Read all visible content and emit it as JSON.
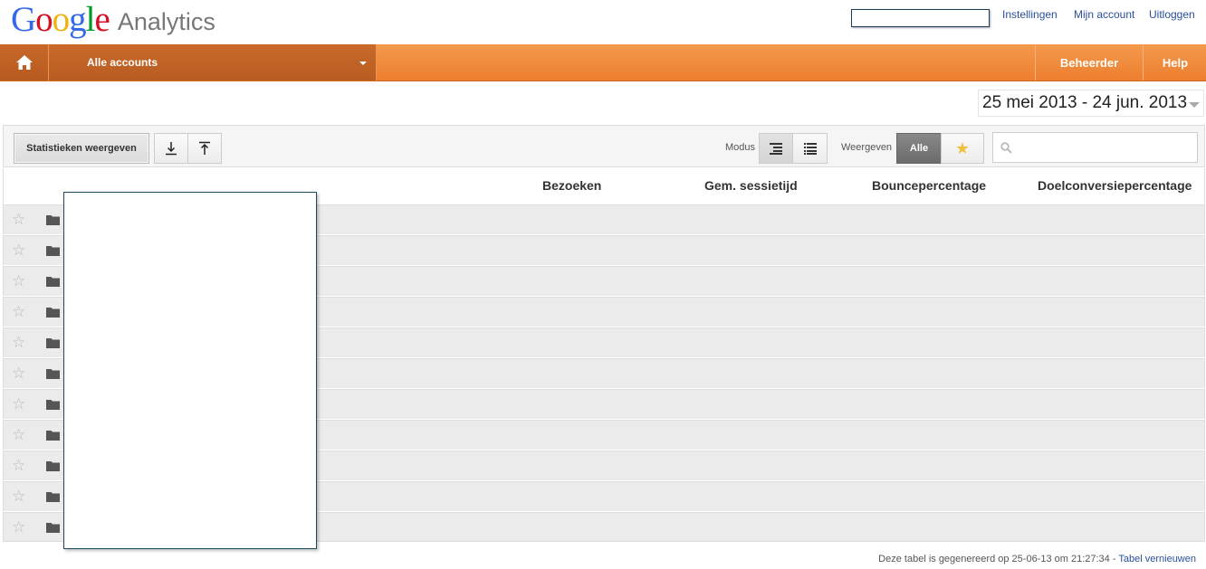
{
  "header": {
    "logo_google": [
      "G",
      "o",
      "o",
      "g",
      "l",
      "e"
    ],
    "logo_product": "Analytics",
    "links": [
      "Instellingen",
      "Mijn account",
      "Uitloggen"
    ]
  },
  "nav": {
    "accounts_label": "Alle accounts",
    "admin_label": "Beheerder",
    "help_label": "Help"
  },
  "date_range": "25 mei 2013 - 24 jun. 2013",
  "toolbar": {
    "stats_button": "Statistieken weergeven",
    "mode_label": "Modus",
    "view_label": "Weergeven",
    "all_button": "Alle"
  },
  "table": {
    "columns": [
      "Bezoeken",
      "Gem. sessietijd",
      "Bouncepercentage",
      "Doelconversiepercentage"
    ],
    "row_count": 11
  },
  "footer": {
    "text": "Deze tabel is gegenereerd op 25-06-13 om 21:27:34 -",
    "refresh_link": "Tabel vernieuwen"
  },
  "colors": {
    "nav_orange": "#ec7e2e",
    "nav_dark": "#b95c21",
    "link_blue": "#2a4f9a"
  }
}
